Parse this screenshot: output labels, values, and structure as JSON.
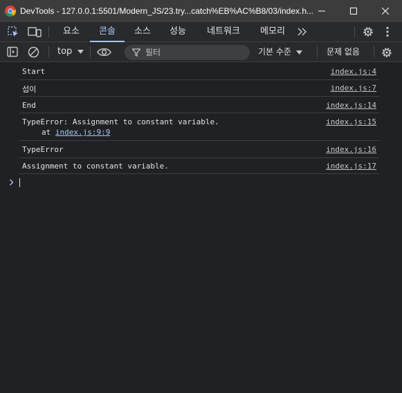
{
  "window": {
    "title": "DevTools - 127.0.0.1:5501/Modern_JS/23.try...catch%EB%AC%B8/03/index.h..."
  },
  "tabs": [
    {
      "label": "요소"
    },
    {
      "label": "콘솔",
      "active": true
    },
    {
      "label": "소스"
    },
    {
      "label": "성능"
    },
    {
      "label": "네트워크"
    },
    {
      "label": "메모리"
    }
  ],
  "toolbar": {
    "context": "top",
    "filter_placeholder": "필터",
    "levels": "기본 수준",
    "issues": "문제 없음"
  },
  "console": {
    "rows": [
      {
        "msg": "Start",
        "src": "index.js:4"
      },
      {
        "msg": "섭이",
        "src": "index.js:7"
      },
      {
        "msg": "End",
        "src": "index.js:14"
      },
      {
        "msg": "TypeError: Assignment to constant variable.",
        "src": "index.js:15",
        "stack_at": "at ",
        "stack_link": "index.js:9:9"
      },
      {
        "msg": "TypeError",
        "src": "index.js:16"
      },
      {
        "msg": "Assignment to constant variable.",
        "src": "index.js:17"
      }
    ]
  },
  "colors": {
    "background": "#202124",
    "accent": "#a8c7fa",
    "titlebar": "#3c3c3c"
  }
}
